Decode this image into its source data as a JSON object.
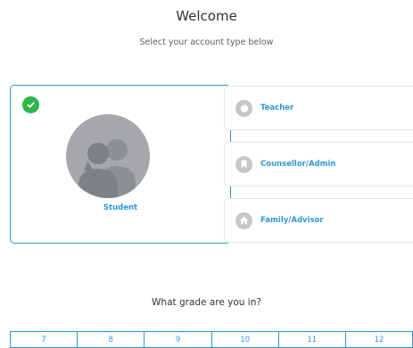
{
  "header": {
    "title": "Welcome",
    "subtitle": "Select your account type below"
  },
  "account_types": {
    "selected": {
      "label": "Student",
      "icon": "student-silhouettes-icon",
      "check_icon": "check-circle-icon"
    },
    "options": [
      {
        "label": "Teacher",
        "icon": "apple-icon"
      },
      {
        "label": "Counsellor/Admin",
        "icon": "bookmark-icon"
      },
      {
        "label": "Family/Advisor",
        "icon": "house-icon"
      }
    ]
  },
  "grade": {
    "question": "What grade are you in?",
    "options": [
      "7",
      "8",
      "9",
      "10",
      "11",
      "12"
    ]
  },
  "colors": {
    "accent": "#2f97d6",
    "check": "#2fb64a",
    "icon_gray": "#c4c6c9"
  }
}
